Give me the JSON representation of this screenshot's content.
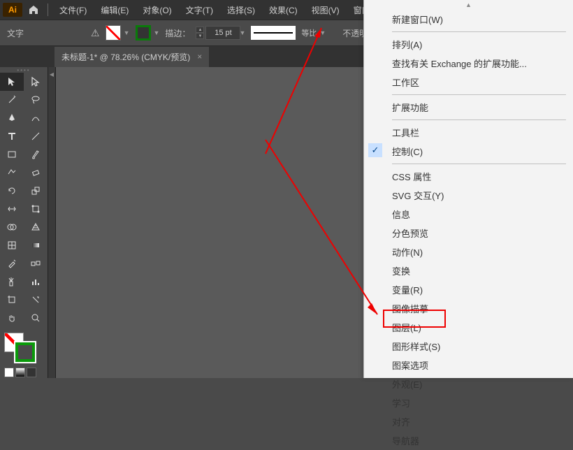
{
  "app": {
    "logo": "Ai"
  },
  "menu": {
    "file": "文件(F)",
    "edit": "编辑(E)",
    "object": "对象(O)",
    "text": "文字(T)",
    "select": "选择(S)",
    "effect": "效果(C)",
    "view": "视图(V)",
    "window": "窗口(W)"
  },
  "options": {
    "tool_label": "文字",
    "stroke_label": "描边：",
    "stroke_value": "15 pt",
    "profile_label": "等比",
    "opacity_label": "不透明度"
  },
  "tab": {
    "title": "未标题-1* @ 78.26% (CMYK/预览)",
    "close": "×"
  },
  "window_menu": {
    "new_window": "新建窗口(W)",
    "arrange": "排列(A)",
    "exchange": "查找有关 Exchange 的扩展功能...",
    "workspace": "工作区",
    "extensions": "扩展功能",
    "toolbar": "工具栏",
    "control": "控制(C)",
    "css_props": "CSS 属性",
    "svg_interact": "SVG 交互(Y)",
    "info": "信息",
    "sep_preview": "分色预览",
    "actions": "动作(N)",
    "transform": "变换",
    "variables": "变量(R)",
    "image_trace": "图像描摹",
    "layers": "图层(L)",
    "graphic_styles": "图形样式(S)",
    "pattern_options": "图案选项",
    "appearance": "外观(E)",
    "learn": "学习",
    "align": "对齐",
    "navigator": "导航器"
  },
  "icons": {
    "home": "home",
    "warning": "warning"
  }
}
